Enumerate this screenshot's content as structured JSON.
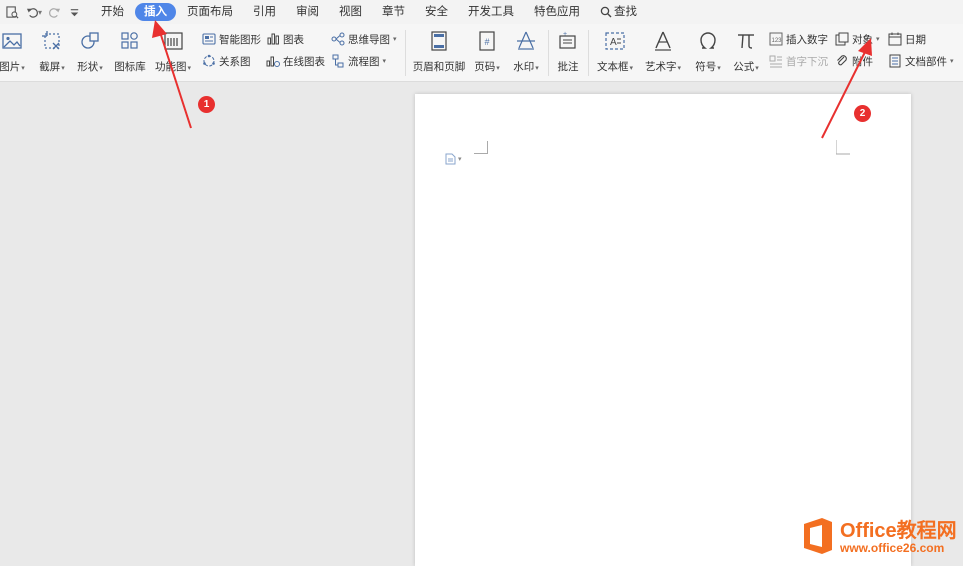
{
  "tabs": [
    "开始",
    "插入",
    "页面布局",
    "引用",
    "审阅",
    "视图",
    "章节",
    "安全",
    "开发工具",
    "特色应用",
    "查找"
  ],
  "active_tab": "插入",
  "ribbon": {
    "picture": "图片",
    "screenshot": "截屏",
    "shapes": "形状",
    "icon_library": "图标库",
    "function_chart": "功能图",
    "smart_graphic": "智能图形",
    "chart": "图表",
    "mind_map": "思维导图",
    "relationship": "关系图",
    "online_chart": "在线图表",
    "flowchart": "流程图",
    "header_footer": "页眉和页脚",
    "page_number": "页码",
    "watermark": "水印",
    "comment": "批注",
    "textbox": "文本框",
    "wordart": "艺术字",
    "symbol": "符号",
    "formula": "公式",
    "insert_number": "插入数字",
    "drop_cap": "首字下沉",
    "object": "对象",
    "attachment": "附件",
    "date": "日期",
    "doc_parts": "文档部件"
  },
  "annotations": {
    "badge1": "1",
    "badge2": "2"
  },
  "watermark": {
    "title": "Office教程网",
    "url": "www.office26.com"
  },
  "colors": {
    "accent": "#4f86e8",
    "arrow": "#e8302f",
    "brand": "#f36f21"
  }
}
